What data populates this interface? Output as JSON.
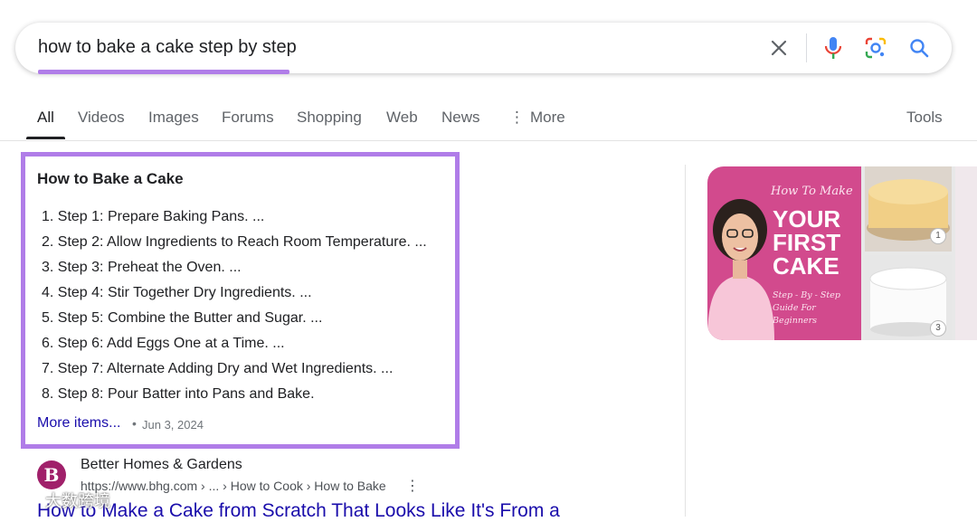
{
  "search": {
    "query": "how to bake a cake step by step"
  },
  "icons": {
    "clear": "close-icon",
    "voice": "mic-icon",
    "lens": "camera-lens-icon",
    "search": "search-icon",
    "more": "vertical-dots-icon"
  },
  "colors": {
    "highlight": "#b07de8",
    "link": "#1a0dab",
    "brand_pink": "#d24a8d"
  },
  "tabs": [
    {
      "label": "All",
      "active": true
    },
    {
      "label": "Videos"
    },
    {
      "label": "Images"
    },
    {
      "label": "Forums"
    },
    {
      "label": "Shopping"
    },
    {
      "label": "Web"
    },
    {
      "label": "News"
    },
    {
      "label": "More"
    }
  ],
  "tools_label": "Tools",
  "snippet": {
    "title": "How to Bake a Cake",
    "steps": [
      "1. Step 1: Prepare Baking Pans. ...",
      "2. Step 2: Allow Ingredients to Reach Room Temperature. ...",
      "3. Step 3: Preheat the Oven. ...",
      "4. Step 4: Stir Together Dry Ingredients. ...",
      "5. Step 5: Combine the Butter and Sugar. ...",
      "6. Step 6: Add Eggs One at a Time. ...",
      "7. Step 7: Alternate Adding Dry and Wet Ingredients. ...",
      "8. Step 8: Pour Batter into Pans and Bake."
    ],
    "more_items": "More items...",
    "separator": "•",
    "date": "Jun 3, 2024"
  },
  "image_panel": {
    "line1": "How To Make",
    "line2": "YOUR FIRST CAKE",
    "line3": "Step - By - Step Guide For Beginners",
    "badge1": "1",
    "badge2": "3"
  },
  "result": {
    "favicon_letter": "B",
    "site_name": "Better Homes & Gardens",
    "url": "https://www.bhg.com › ... › How to Cook › How to Bake",
    "title": "How to Make a Cake from Scratch That Looks Like It's From a"
  },
  "watermark_text": "大数跨境"
}
